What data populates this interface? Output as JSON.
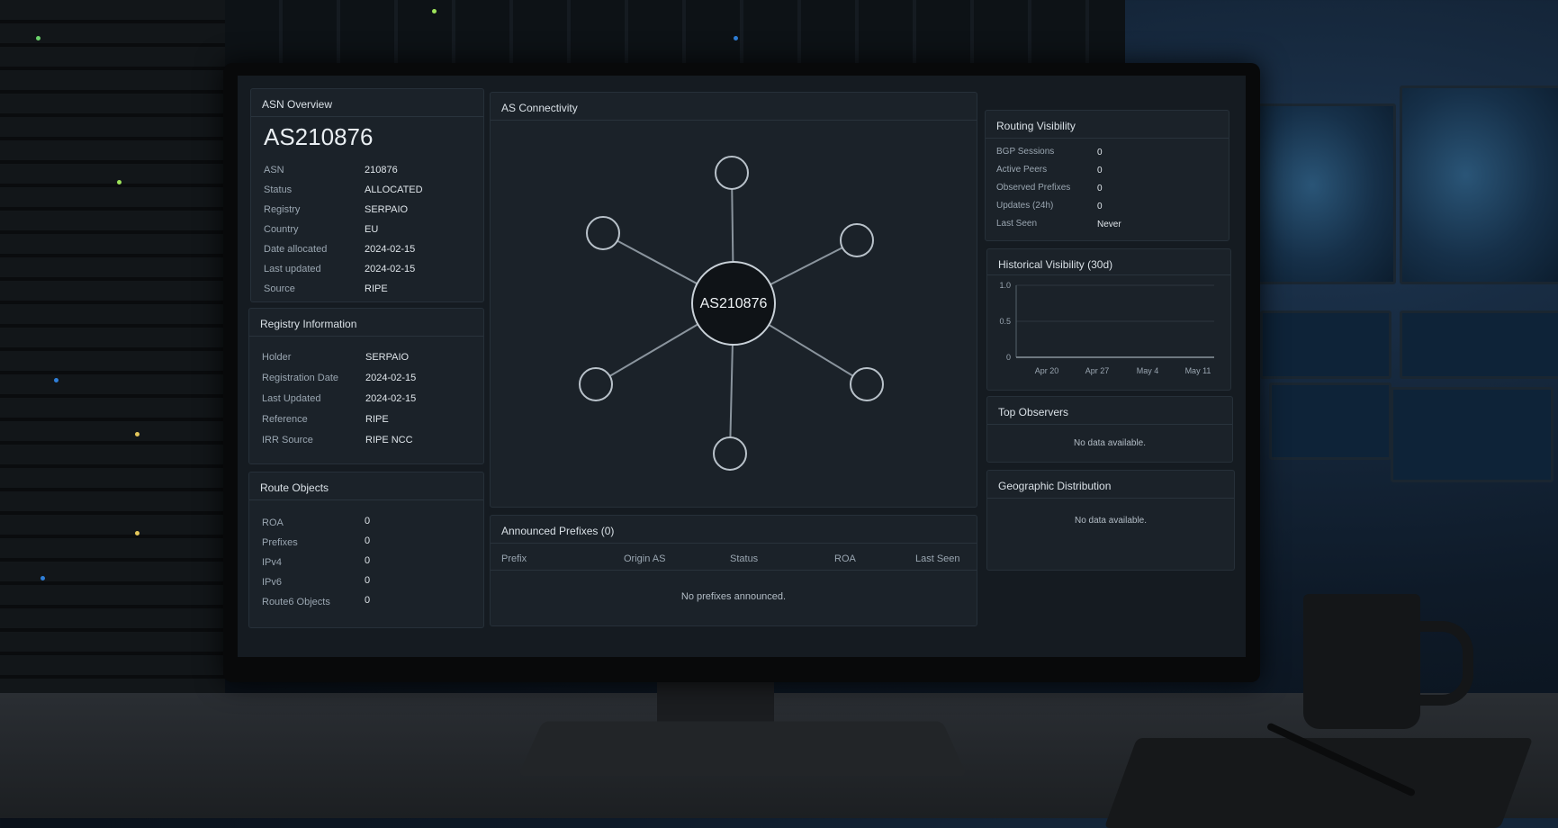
{
  "asn_overview": {
    "title": "ASN Overview",
    "asn_heading": "AS210876",
    "fields": [
      {
        "label": "ASN",
        "value": "210876"
      },
      {
        "label": "Status",
        "value": "ALLOCATED"
      },
      {
        "label": "Registry",
        "value": "SERPAIO"
      },
      {
        "label": "Country",
        "value": "EU"
      },
      {
        "label": "Date allocated",
        "value": "2024-02-15"
      },
      {
        "label": "Last updated",
        "value": "2024-02-15"
      },
      {
        "label": "Source",
        "value": "RIPE"
      }
    ]
  },
  "registry_information": {
    "title": "Registry Information",
    "fields": [
      {
        "label": "Holder",
        "value": "SERPAIO"
      },
      {
        "label": "Registration Date",
        "value": "2024-02-15"
      },
      {
        "label": "Last Updated",
        "value": "2024-02-15"
      },
      {
        "label": "Reference",
        "value": "RIPE"
      },
      {
        "label": "IRR Source",
        "value": "RIPE NCC"
      }
    ]
  },
  "route_objects": {
    "title": "Route Objects",
    "fields": [
      {
        "label": "ROA",
        "value": "0"
      },
      {
        "label": "Prefixes",
        "value": "0"
      },
      {
        "label": "IPv4",
        "value": "0"
      },
      {
        "label": "IPv6",
        "value": "0"
      },
      {
        "label": "Route6 Objects",
        "value": "0"
      }
    ]
  },
  "as_connectivity": {
    "title": "AS Connectivity",
    "center_label": "AS210876",
    "peer_count": 6
  },
  "announced_prefixes": {
    "title": "Announced Prefixes (0)",
    "columns": [
      "Prefix",
      "Origin AS",
      "Status",
      "ROA",
      "Last Seen"
    ],
    "empty_text": "No prefixes announced."
  },
  "routing_visibility": {
    "title": "Routing Visibility",
    "fields": [
      {
        "label": "BGP Sessions",
        "value": "0"
      },
      {
        "label": "Active Peers",
        "value": "0"
      },
      {
        "label": "Observed Prefixes",
        "value": "0"
      },
      {
        "label": "Updates (24h)",
        "value": "0"
      },
      {
        "label": "Last Seen",
        "value": "Never"
      }
    ]
  },
  "historical_visibility": {
    "title": "Historical Visibility (30d)"
  },
  "chart_data": {
    "type": "line",
    "title": "Historical Visibility (30d)",
    "x": [
      "Apr 20",
      "Apr 27",
      "May 4",
      "May 11"
    ],
    "series": [
      {
        "values": [
          0,
          0,
          0,
          0
        ]
      }
    ],
    "ylim": [
      0,
      1.0
    ],
    "yticks": [
      "1.0",
      "0.5",
      "0"
    ],
    "grid": true
  },
  "top_observers": {
    "title": "Top Observers",
    "empty_text": "No data available."
  },
  "geographic_distribution": {
    "title": "Geographic Distribution",
    "empty_text": "No data available."
  },
  "colors": {
    "panel_bg": "#1b2229",
    "screen_bg": "#151b21",
    "text": "#dfe5ea",
    "muted": "#9aa6b1"
  }
}
